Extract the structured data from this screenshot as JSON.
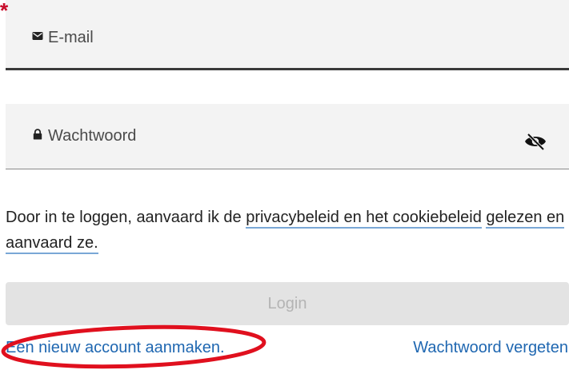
{
  "email_field": {
    "required_marker": "*",
    "icon": "envelope-icon",
    "placeholder": "E-mail",
    "value": ""
  },
  "password_field": {
    "required_marker": "*",
    "icon": "lock-icon",
    "placeholder": "Wachtwoord",
    "value": "",
    "toggle_icon": "eye-slash-icon"
  },
  "consent": {
    "text_before": "Door in te loggen, aanvaard ik de ",
    "link_text_1": "privacybeleid en het cookiebeleid",
    "text_between": " ",
    "link_text_2": "gelezen en aanvaard ze."
  },
  "login_button": {
    "label": "Login",
    "enabled": false
  },
  "links": {
    "create_account": "Een nieuw account aanmaken.",
    "forgot_password": "Wachtwoord vergeten"
  },
  "colors": {
    "required": "#c8102e",
    "link": "#1f67b1",
    "underline": "#79a7d6",
    "annotation": "#e0101e"
  }
}
